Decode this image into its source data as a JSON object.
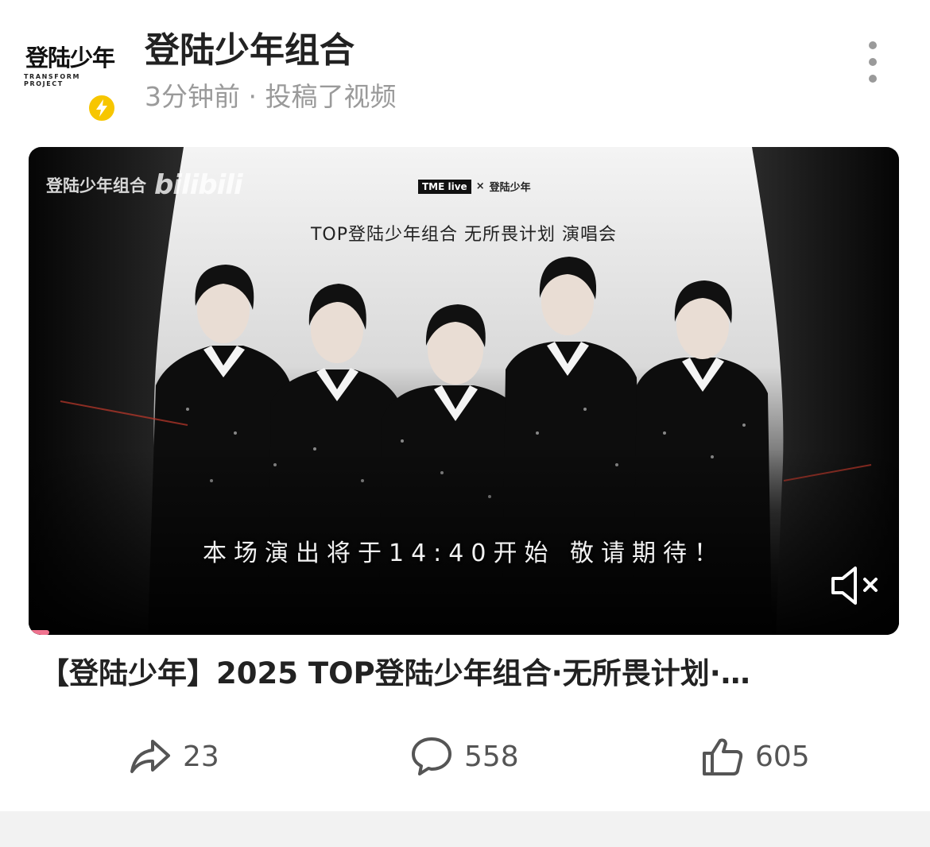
{
  "header": {
    "avatar_main": "登陆少年",
    "avatar_sub": "TRANSFORM PROJECT",
    "account_name": "登陆少年组合",
    "post_meta": "3分钟前 · 投稿了视频",
    "verified_color": "#f7c600"
  },
  "video": {
    "watermark_text": "登陆少年组合",
    "watermark_logo": "bilibili",
    "sponsor_left": "TME live",
    "sponsor_times": "×",
    "sponsor_right": "登陆少年",
    "concert_title": "TOP登陆少年组合 无所畏计划 演唱会",
    "notice_text": "本场演出将于14:40开始 敬请期待！",
    "mute_icon": "speaker-muted-icon",
    "progress_color": "#f0738f"
  },
  "post": {
    "title": "【登陆少年】2025 TOP登陆少年组合·无所畏计划·…"
  },
  "actions": {
    "share_count": "23",
    "comment_count": "558",
    "like_count": "605"
  },
  "footer": {
    "watermark": ""
  }
}
